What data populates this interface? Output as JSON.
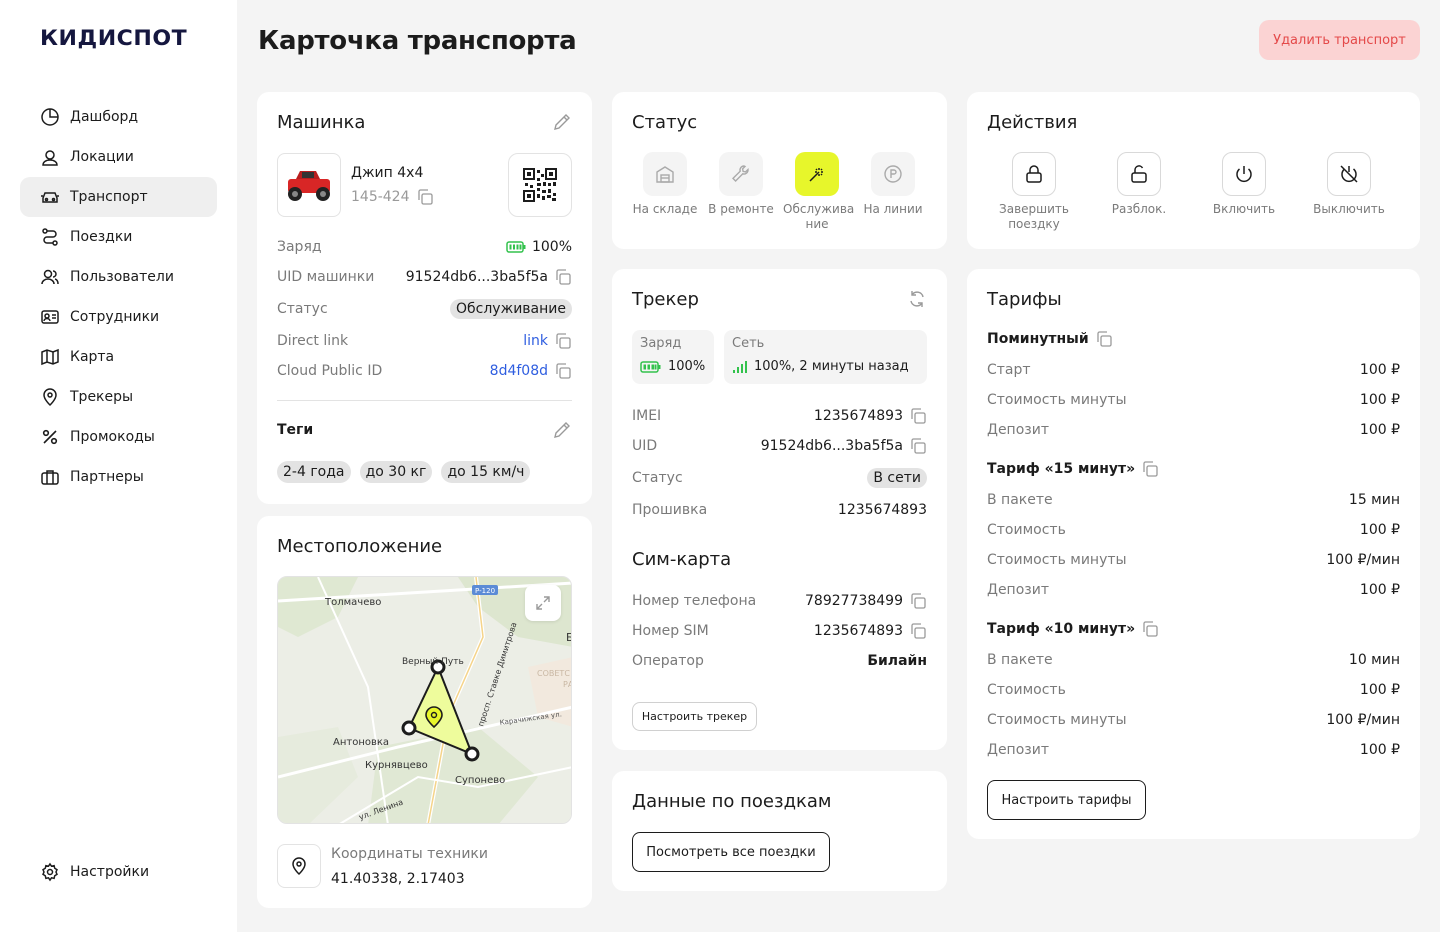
{
  "brand": "КИДИСПОТ",
  "page_title": "Карточка транспорта",
  "delete_button": "Удалить транспорт",
  "sidebar": {
    "items": [
      {
        "label": "Дашборд",
        "icon": "dashboard-icon"
      },
      {
        "label": "Локации",
        "icon": "location-user-icon"
      },
      {
        "label": "Транспорт",
        "icon": "car-icon",
        "active": true
      },
      {
        "label": "Поездки",
        "icon": "route-icon"
      },
      {
        "label": "Пользователи",
        "icon": "users-icon"
      },
      {
        "label": "Сотрудники",
        "icon": "id-card-icon"
      },
      {
        "label": "Карта",
        "icon": "map-icon"
      },
      {
        "label": "Трекеры",
        "icon": "pin-icon"
      },
      {
        "label": "Промокоды",
        "icon": "percent-icon"
      },
      {
        "label": "Партнеры",
        "icon": "briefcase-icon"
      }
    ],
    "settings": "Настройки"
  },
  "machine": {
    "title": "Машинка",
    "name": "Джип 4x4",
    "number": "145-424",
    "charge_label": "Заряд",
    "charge_value": "100%",
    "uid_label": "UID машинки",
    "uid_value": "91524db6...3ba5f5a",
    "status_label": "Статус",
    "status_value": "Обслуживание",
    "direct_label": "Direct link",
    "direct_value": "link",
    "cloud_label": "Cloud Public ID",
    "cloud_value": "8d4f08d",
    "tags_title": "Теги",
    "tags": [
      "2-4 года",
      "до 30 кг",
      "до 15 км/ч"
    ]
  },
  "location": {
    "title": "Местоположение",
    "map_labels": {
      "tolmachevo": "Толмачево",
      "verny_put": "Верный Путь",
      "antonovka": "Антоновка",
      "kurnyavtsevo": "Курнявцево",
      "suponevo": "Супонево",
      "prospekt": "просп. Ставке Димитрова",
      "karachizhskaya": "Карачижская ул.",
      "lenina": "ул. Ленина",
      "road": "Р-120",
      "sovetsky": "СОВЕТС",
      "rayon": "РАЙ",
      "edge_b": "Б"
    },
    "coords_label": "Координаты техники",
    "coords_value": "41.40338, 2.17403"
  },
  "status": {
    "title": "Статус",
    "items": [
      {
        "label": "На складе",
        "icon": "warehouse-icon",
        "active": false
      },
      {
        "label": "В ремонте",
        "icon": "wrench-icon",
        "active": false
      },
      {
        "label": "Обслужива ние",
        "icon": "magic-wand-icon",
        "active": true
      },
      {
        "label": "На линии",
        "icon": "parking-icon",
        "active": false
      }
    ]
  },
  "tracker": {
    "title": "Трекер",
    "charge_label": "Заряд",
    "charge_value": "100%",
    "network_label": "Сеть",
    "network_value": "100%, 2 минуты назад",
    "imei_label": "IMEI",
    "imei_value": "1235674893",
    "uid_label": "UID",
    "uid_value": "91524db6...3ba5f5a",
    "status_label": "Статус",
    "status_value": "В сети",
    "firmware_label": "Прошивка",
    "firmware_value": "1235674893",
    "sim_title": "Сим-карта",
    "phone_label": "Номер телефона",
    "phone_value": "78927738499",
    "sim_label": "Номер SIM",
    "sim_value": "1235674893",
    "operator_label": "Оператор",
    "operator_value": "Билайн",
    "setup_button": "Настроить трекер"
  },
  "trips": {
    "title": "Данные по поездкам",
    "button": "Посмотреть все поездки"
  },
  "actions": {
    "title": "Действия",
    "items": [
      {
        "label": "Завершить поездку",
        "icon": "lock-icon"
      },
      {
        "label": "Разблок.",
        "icon": "unlock-icon"
      },
      {
        "label": "Включить",
        "icon": "power-icon"
      },
      {
        "label": "Выключить",
        "icon": "power-off-icon"
      }
    ]
  },
  "tariffs": {
    "title": "Тарифы",
    "minute": {
      "name": "Поминутный",
      "rows": [
        {
          "label": "Старт",
          "value": "100 ₽"
        },
        {
          "label": "Стоимость минуты",
          "value": "100 ₽"
        },
        {
          "label": "Депозит",
          "value": "100 ₽"
        }
      ]
    },
    "t15": {
      "name": "Тариф «15 минут»",
      "rows": [
        {
          "label": "В пакете",
          "value": "15 мин"
        },
        {
          "label": "Стоимость",
          "value": "100 ₽"
        },
        {
          "label": "Стоимость минуты",
          "value": "100 ₽/мин"
        },
        {
          "label": "Депозит",
          "value": "100 ₽"
        }
      ]
    },
    "t10": {
      "name": "Тариф «10 минут»",
      "rows": [
        {
          "label": "В пакете",
          "value": "10 мин"
        },
        {
          "label": "Стоимость",
          "value": "100 ₽"
        },
        {
          "label": "Стоимость минуты",
          "value": "100 ₽/мин"
        },
        {
          "label": "Депозит",
          "value": "100 ₽"
        }
      ]
    },
    "button": "Настроить тарифы"
  },
  "colors": {
    "accent": "#e7f62b",
    "danger_bg": "#fbd3d3",
    "danger_text": "#e44949",
    "link": "#2f5ee0",
    "battery": "#33c24d"
  }
}
